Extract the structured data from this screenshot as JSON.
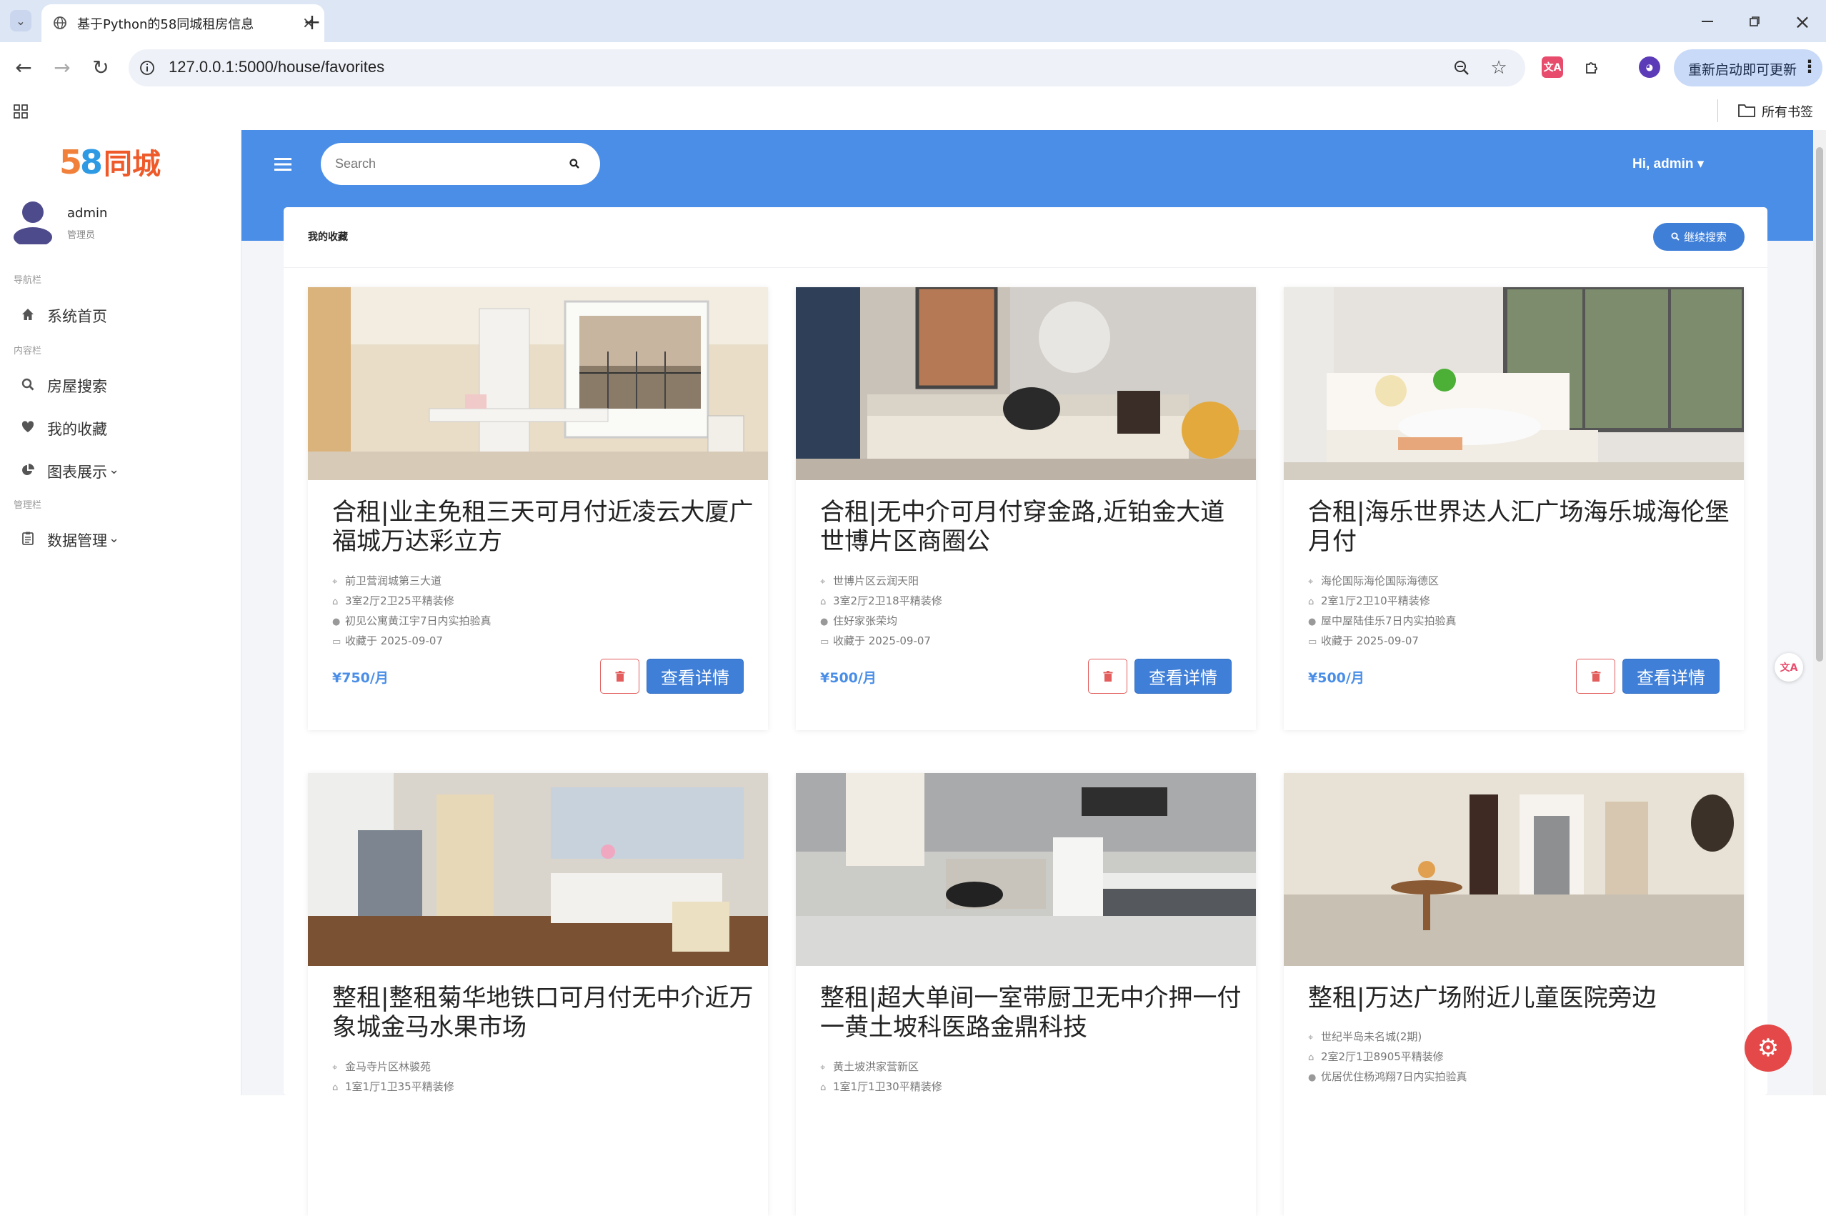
{
  "browser": {
    "tab_title": "基于Python的58同城租房信息",
    "new_tab": "+",
    "url": "127.0.0.1:5000/house/favorites",
    "update_button": "重新启动即可更新",
    "bookmarks_label": "所有书签"
  },
  "sidebar": {
    "logo_num": "58",
    "logo_text": "同城",
    "user_name": "admin",
    "user_role": "管理员",
    "sections": [
      {
        "label": "导航栏",
        "items": [
          {
            "label": "系统首页",
            "icon": "home-icon"
          }
        ]
      },
      {
        "label": "内容栏",
        "items": [
          {
            "label": "房屋搜索",
            "icon": "search-icon"
          },
          {
            "label": "我的收藏",
            "icon": "heart-icon"
          },
          {
            "label": "图表展示",
            "icon": "pie-chart-icon",
            "chevron": "⌄"
          }
        ]
      },
      {
        "label": "管理栏",
        "items": [
          {
            "label": "数据管理",
            "icon": "clipboard-icon",
            "chevron": "⌄"
          }
        ]
      }
    ]
  },
  "header": {
    "search_placeholder": "Search",
    "user_menu": "Hi, admin ▾"
  },
  "panel": {
    "title": "我的收藏",
    "continue_button": "继续搜索"
  },
  "cards": [
    {
      "title": "合租|业主免租三天可月付近凌云大厦广福城万达彩立方",
      "address": "前卫营润城第三大道",
      "layout": "3室2厅2卫25平精装修",
      "agent": "初见公寓黄江宇7日内实拍验真",
      "saved": "收藏于 2025-09-07",
      "price": "¥750/月",
      "view_label": "查看详情"
    },
    {
      "title": "合租|无中介可月付穿金路,近铂金大道世博片区商圈公",
      "address": "世博片区云润天阳",
      "layout": "3室2厅2卫18平精装修",
      "agent": "住好家张荣均",
      "saved": "收藏于 2025-09-07",
      "price": "¥500/月",
      "view_label": "查看详情"
    },
    {
      "title": "合租|海乐世界达人汇广场海乐城海伦堡月付",
      "address": "海伦国际海伦国际海德区",
      "layout": "2室1厅2卫10平精装修",
      "agent": "屋中屋陆佳乐7日内实拍验真",
      "saved": "收藏于 2025-09-07",
      "price": "¥500/月",
      "view_label": "查看详情"
    },
    {
      "title": "整租|整租菊华地铁口可月付无中介近万象城金马水果市场",
      "address": "金马寺片区林骏苑",
      "layout": "1室1厅1卫35平精装修"
    },
    {
      "title": "整租|超大单间一室带厨卫无中介押一付一黄土坡科医路金鼎科技",
      "address": "黄土坡洪家营新区",
      "layout": "1室1厅1卫30平精装修"
    },
    {
      "title": "整租|万达广场附近儿童医院旁边",
      "address": "世纪半岛未名城(2期)",
      "layout": "2室2厅1卫8905平精装修",
      "agent": "优居优住杨鸿翔7日内实拍验真"
    }
  ]
}
